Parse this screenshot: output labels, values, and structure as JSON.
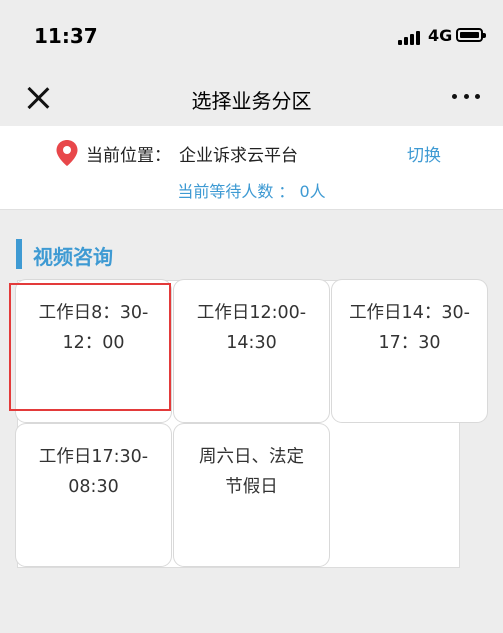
{
  "status_bar": {
    "time": "11:37",
    "network": "4G"
  },
  "nav": {
    "title": "选择业务分区",
    "close_icon": "close-icon",
    "more_icon": "more-icon"
  },
  "info": {
    "location_label": "当前位置：",
    "location_value": "企业诉求云平台",
    "switch_label": "切换",
    "waiting_text": "当前等待人数 ： 0人"
  },
  "section": {
    "title": "视频咨询"
  },
  "slots": [
    {
      "line1": "工作日8：30-",
      "line2": "12：00"
    },
    {
      "line1": "工作日12:00-",
      "line2": "14:30"
    },
    {
      "line1": "工作日14：30-",
      "line2": "17：30"
    },
    {
      "line1": "工作日17:30-",
      "line2": "08:30"
    },
    {
      "line1": "周六日、法定",
      "line2": "节假日"
    }
  ],
  "colors": {
    "accent": "#3e9ad3",
    "highlight": "#e33a3a",
    "pin": "#e8474a"
  }
}
